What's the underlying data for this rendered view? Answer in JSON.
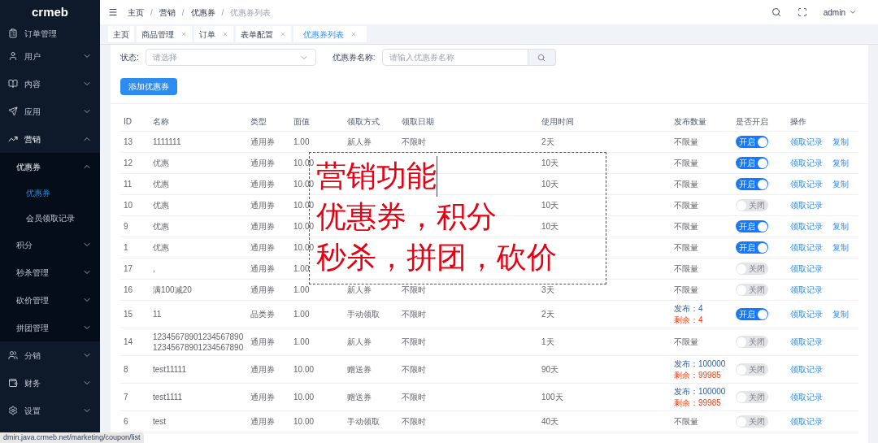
{
  "sidebar": {
    "logo": "crmeb",
    "items": [
      {
        "label": "订单管理",
        "expanded": false
      },
      {
        "label": "用户",
        "expanded": false
      },
      {
        "label": "内容",
        "expanded": false
      },
      {
        "label": "应用",
        "expanded": false
      },
      {
        "label": "营销",
        "expanded": true,
        "children": [
          {
            "label": "优惠券",
            "expanded": true,
            "children": [
              {
                "label": "优惠券",
                "selected": true
              },
              {
                "label": "会员领取记录",
                "selected": false
              }
            ]
          },
          {
            "label": "积分",
            "expanded": false
          },
          {
            "label": "秒杀管理",
            "expanded": false
          },
          {
            "label": "砍价管理",
            "expanded": false
          },
          {
            "label": "拼团管理",
            "expanded": false
          }
        ]
      },
      {
        "label": "分销",
        "expanded": false
      },
      {
        "label": "财务",
        "expanded": false
      },
      {
        "label": "设置",
        "expanded": false
      }
    ]
  },
  "breadcrumb": {
    "items": [
      "主页",
      "营销",
      "优惠券",
      "优惠券列表"
    ],
    "separator": "/"
  },
  "user": "admin",
  "tags": [
    {
      "label": "主页",
      "closable": false,
      "selected": false
    },
    {
      "label": "商品管理",
      "closable": true,
      "selected": false
    },
    {
      "label": "订单",
      "closable": true,
      "selected": false
    },
    {
      "label": "表单配置",
      "closable": true,
      "selected": false
    },
    {
      "label": "优惠券列表",
      "closable": true,
      "selected": true
    }
  ],
  "filters": {
    "status_label": "状态:",
    "status_placeholder": "请选择",
    "name_label": "优惠券名称:",
    "name_placeholder": "请输入优惠券名称"
  },
  "add_button": "添加优惠券",
  "table": {
    "columns": [
      "ID",
      "名称",
      "类型",
      "面值",
      "领取方式",
      "领取日期",
      "使用时间",
      "发布数量",
      "是否开启",
      "操作"
    ],
    "rows": [
      {
        "id": "13",
        "name": "1111111",
        "type": "通用券",
        "value": "1.00",
        "method": "新人券",
        "date": "不限时",
        "usage": "2天",
        "quantity": {
          "kind": "unlimited",
          "text": "不限量"
        },
        "on": true,
        "switch_label": "开启",
        "actions": [
          "领取记录",
          "复制"
        ]
      },
      {
        "id": "12",
        "name": "优惠",
        "type": "通用券",
        "value": "10.00",
        "usage": "10天",
        "quantity": {
          "kind": "unlimited",
          "text": "不限量"
        },
        "on": true,
        "switch_label": "开启",
        "actions": [
          "领取记录",
          "复制"
        ]
      },
      {
        "id": "11",
        "name": "优惠",
        "type": "通用券",
        "value": "10.00",
        "usage": "10天",
        "quantity": {
          "kind": "unlimited",
          "text": "不限量"
        },
        "on": true,
        "switch_label": "开启",
        "actions": [
          "领取记录",
          "复制"
        ]
      },
      {
        "id": "10",
        "name": "优惠",
        "type": "通用券",
        "value": "10.00",
        "usage": "10天",
        "quantity": {
          "kind": "unlimited",
          "text": "不限量"
        },
        "on": false,
        "switch_label": "关闭",
        "actions": [
          "领取记录"
        ]
      },
      {
        "id": "9",
        "name": "优惠",
        "type": "通用券",
        "value": "10.00",
        "usage": "10天",
        "quantity": {
          "kind": "unlimited",
          "text": "不限量"
        },
        "on": true,
        "switch_label": "开启",
        "actions": [
          "领取记录",
          "复制"
        ]
      },
      {
        "id": "1",
        "name": "优惠",
        "type": "通用券",
        "value": "10.00",
        "quantity": {
          "kind": "unlimited",
          "text": "不限量"
        },
        "on": true,
        "switch_label": "开启",
        "actions": [
          "领取记录",
          "复制"
        ]
      },
      {
        "id": "17",
        "name": ",",
        "type": "通用券",
        "value": "1.00",
        "quantity": {
          "kind": "unlimited",
          "text": "不限量"
        },
        "on": false,
        "switch_label": "关闭",
        "actions": [
          "领取记录"
        ]
      },
      {
        "id": "16",
        "name": "满100减20",
        "type": "通用券",
        "value": "1.00",
        "method": "新人券",
        "date": "不限时",
        "usage": "3天",
        "quantity": {
          "kind": "unlimited",
          "text": "不限量"
        },
        "on": false,
        "switch_label": "关闭",
        "actions": [
          "领取记录"
        ]
      },
      {
        "id": "15",
        "name": "11",
        "type": "品类券",
        "value": "1.00",
        "method": "手动领取",
        "date": "不限时",
        "usage": "2天",
        "quantity": {
          "kind": "limited",
          "published": "发布：4",
          "remaining": "剩余：4"
        },
        "on": true,
        "switch_label": "开启",
        "actions": [
          "领取记录",
          "复制"
        ]
      },
      {
        "id": "14",
        "name": "1234567890123456789012345678901234567890",
        "type": "通用券",
        "value": "1.00",
        "method": "新人券",
        "date": "不限时",
        "usage": "1天",
        "quantity": {
          "kind": "unlimited",
          "text": "不限量"
        },
        "on": false,
        "switch_label": "关闭",
        "actions": [
          "领取记录"
        ]
      },
      {
        "id": "8",
        "name": "test11111",
        "type": "通用券",
        "value": "10.00",
        "method": "赠送券",
        "date": "不限时",
        "usage": "90天",
        "quantity": {
          "kind": "limited",
          "published": "发布：100000",
          "remaining": "剩余：99985"
        },
        "on": false,
        "switch_label": "关闭",
        "actions": [
          "领取记录"
        ]
      },
      {
        "id": "7",
        "name": "test1111",
        "type": "通用券",
        "value": "10.00",
        "method": "赠送券",
        "date": "不限时",
        "usage": "100天",
        "quantity": {
          "kind": "limited",
          "published": "发布：100000",
          "remaining": "剩余：99985"
        },
        "on": false,
        "switch_label": "关闭",
        "actions": [
          "领取记录"
        ]
      },
      {
        "id": "6",
        "name": "test",
        "type": "通用券",
        "value": "10.00",
        "method": "手动领取",
        "date": "不限时",
        "usage": "40天",
        "quantity": {
          "kind": "unlimited",
          "text": "不限量"
        },
        "on": false,
        "switch_label": "关闭",
        "actions": [
          "领取记录"
        ]
      }
    ]
  },
  "annotation": {
    "lines": [
      "营销功能",
      "优惠券，积分",
      "秒杀，拼团，砍价"
    ]
  },
  "status_url": "dmin.java.crmeb.net/marketing/coupon/list"
}
